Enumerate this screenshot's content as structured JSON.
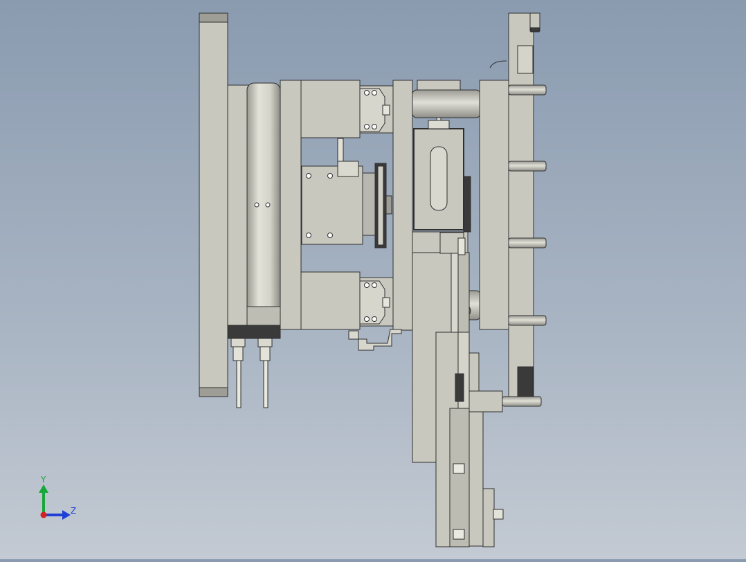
{
  "viewport": {
    "background_top": "#8a9bb0",
    "background_bottom": "#c3cad3"
  },
  "model": {
    "part_fill": "#c8c8bf",
    "part_stroke": "#2f2f2f",
    "dark_fill": "#3a3a3a"
  },
  "triad": {
    "y_label": "Y",
    "z_label": "Z",
    "y_color": "#18a83a",
    "z_color": "#1f3fd6",
    "x_color": "#d42020"
  }
}
